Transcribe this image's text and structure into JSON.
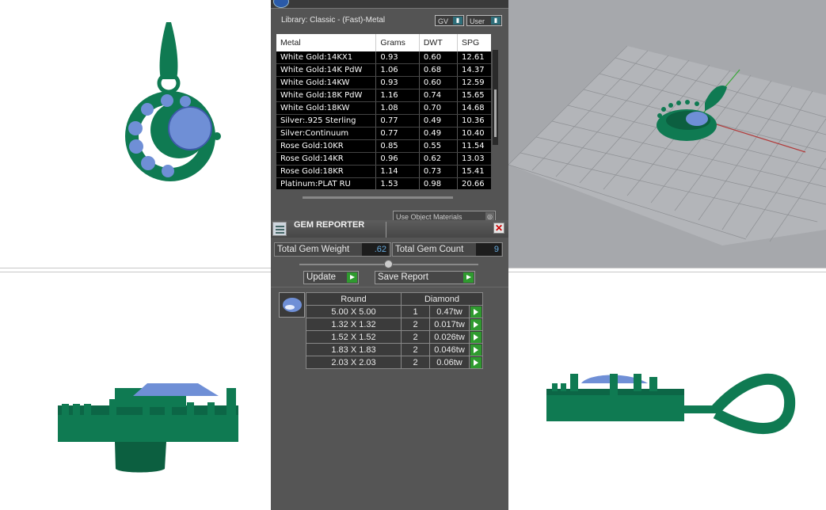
{
  "library": {
    "header": "Library: Classic - (Fast)-Metal",
    "gv_select": "GV",
    "user_select": "User",
    "columns": [
      "Metal",
      "Grams",
      "DWT",
      "SPG"
    ],
    "rows": [
      [
        "White Gold:14KX1",
        "0.93",
        "0.60",
        "12.61"
      ],
      [
        "White Gold:14K PdW",
        "1.06",
        "0.68",
        "14.37"
      ],
      [
        "White Gold:14KW",
        "0.93",
        "0.60",
        "12.59"
      ],
      [
        "White Gold:18K PdW",
        "1.16",
        "0.74",
        "15.65"
      ],
      [
        "White Gold:18KW",
        "1.08",
        "0.70",
        "14.68"
      ],
      [
        "Silver:.925 Sterling",
        "0.77",
        "0.49",
        "10.36"
      ],
      [
        "Silver:Continuum",
        "0.77",
        "0.49",
        "10.40"
      ],
      [
        "Rose Gold:10KR",
        "0.85",
        "0.55",
        "11.54"
      ],
      [
        "Rose Gold:14KR",
        "0.96",
        "0.62",
        "13.03"
      ],
      [
        "Rose Gold:18KR",
        "1.14",
        "0.73",
        "15.41"
      ],
      [
        "Platinum:PLAT RU",
        "1.53",
        "0.98",
        "20.66"
      ]
    ],
    "use_object_materials": "Use Object Materials"
  },
  "gem_reporter": {
    "title": "GEM REPORTER",
    "close_glyph": "✕",
    "total_weight_label": "Total Gem Weight",
    "total_weight_value": ".62",
    "total_count_label": "Total Gem Count",
    "total_count_value": "9",
    "update_label": "Update",
    "save_report_label": "Save Report",
    "table": {
      "shape": "Round",
      "type": "Diamond",
      "rows": [
        [
          "5.00 X 5.00",
          "1",
          "0.47tw"
        ],
        [
          "1.32 X 1.32",
          "2",
          "0.017tw"
        ],
        [
          "1.52 X 1.52",
          "2",
          "0.026tw"
        ],
        [
          "1.83 X 1.83",
          "2",
          "0.046tw"
        ],
        [
          "2.03 X 2.03",
          "2",
          "0.06tw"
        ]
      ]
    }
  },
  "colors": {
    "metal": "#0f7a52",
    "gem": "#6f8fd6",
    "panel": "#555555",
    "accent_play": "#2f9a2f"
  }
}
